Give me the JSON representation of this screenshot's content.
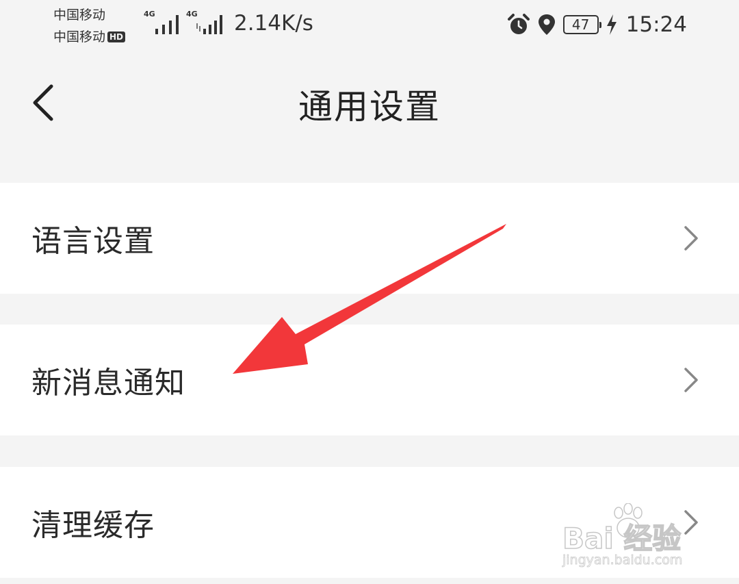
{
  "status_bar": {
    "carrier_1": "中国移动",
    "carrier_2": "中国移动",
    "hd_badge": "HD",
    "network_1": "4G",
    "network_2": "4G",
    "speed": "2.14K/s",
    "battery": "47",
    "time": "15:24"
  },
  "header": {
    "title": "通用设置"
  },
  "settings": {
    "items": [
      {
        "label": "语言设置"
      },
      {
        "label": "新消息通知"
      },
      {
        "label": "清理缓存"
      }
    ]
  },
  "annotation": {
    "arrow_color": "#f2373a"
  },
  "watermark": {
    "brand": "Bai  经验",
    "url": "jingyan.baidu.com"
  }
}
